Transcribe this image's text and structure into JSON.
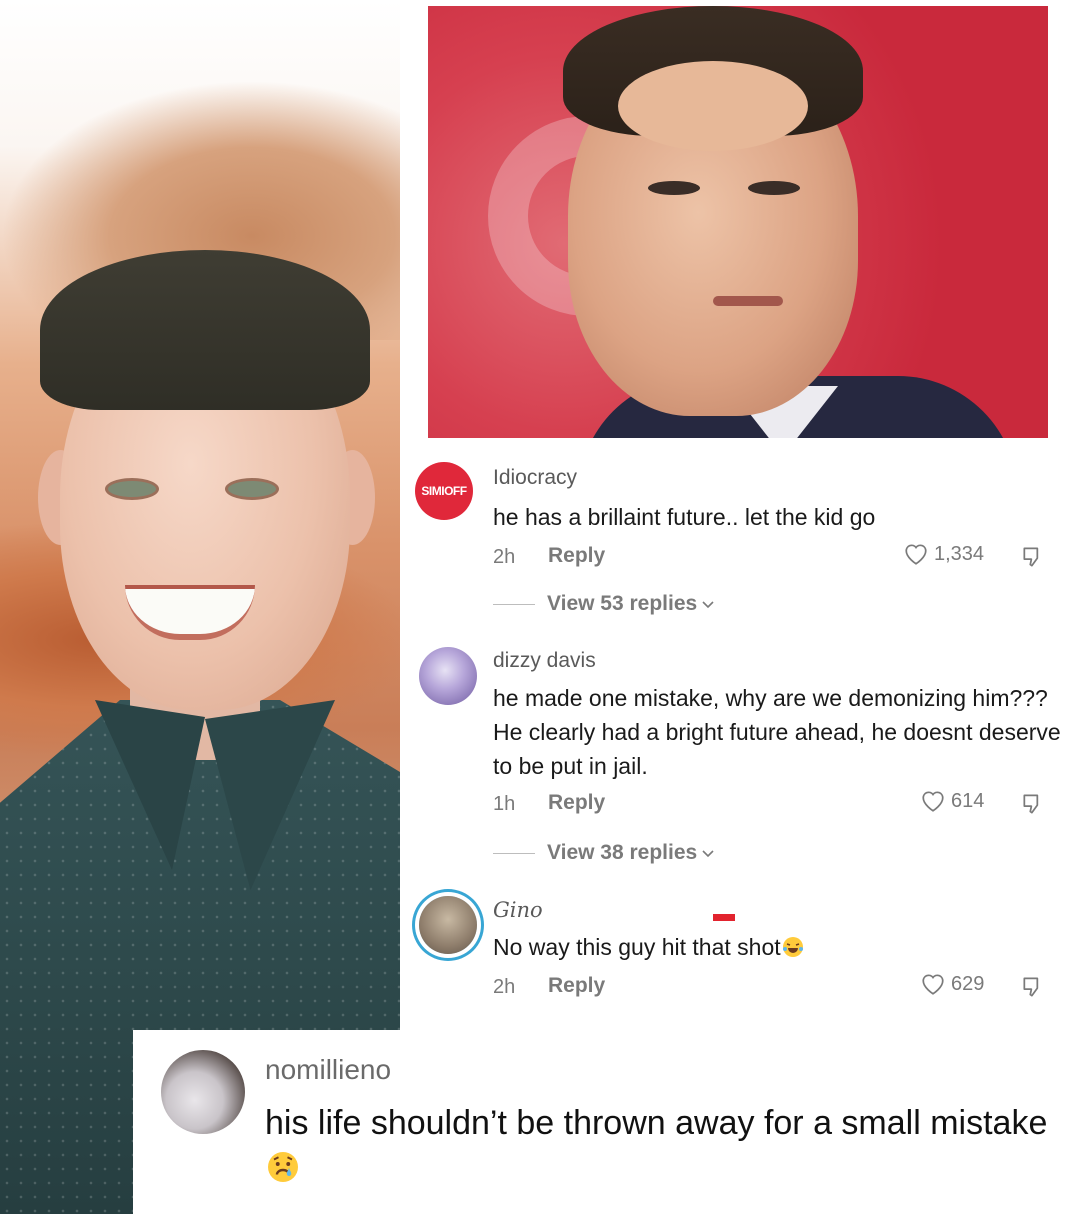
{
  "comments": [
    {
      "avatar_text": "SIMIOFF",
      "username": "Idiocracy",
      "text": "he has a brillaint future.. let the kid go",
      "time": "2h",
      "reply_label": "Reply",
      "likes": "1,334",
      "view_replies": "View 53 replies"
    },
    {
      "username": "dizzy davis",
      "text": "he made one mistake, why are we demonizing him??? He clearly had a bright future ahead, he doesnt deserve to be put in jail.",
      "time": "1h",
      "reply_label": "Reply",
      "likes": "614",
      "view_replies": "View 38 replies"
    },
    {
      "username": "Gino",
      "text": "No way this guy hit that shot",
      "emoji": "laughing-crying-face",
      "time": "2h",
      "reply_label": "Reply",
      "likes": "629"
    }
  ],
  "overlay_comment": {
    "username": "nomillieno",
    "text": "his life shouldn’t be thrown away for a small mistake",
    "emoji": "crying-face"
  },
  "colors": {
    "accent_red": "#e0283a",
    "story_ring": "#38a6d4"
  }
}
